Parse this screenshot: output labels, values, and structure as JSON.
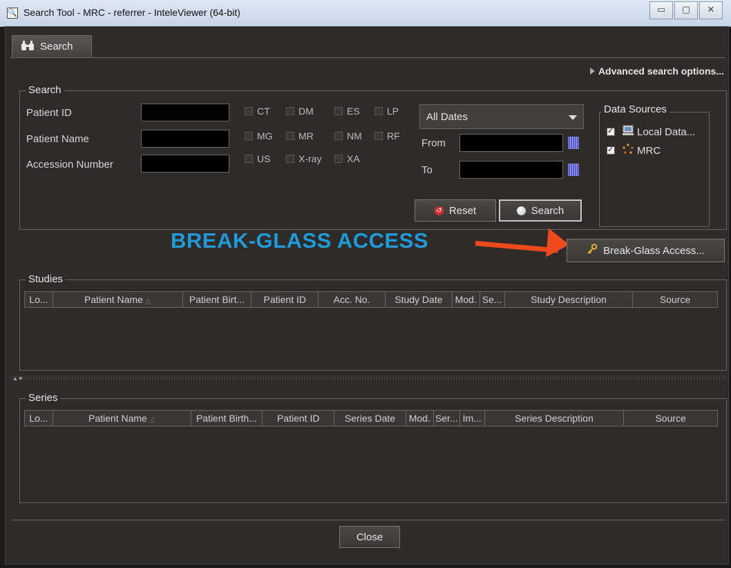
{
  "window": {
    "title": "Search Tool - MRC - referrer - InteleViewer (64-bit)",
    "controls": [
      "▭",
      "▢",
      "✕"
    ]
  },
  "tab": {
    "label": "Search"
  },
  "advanced": {
    "label": "Advanced search options..."
  },
  "search_group": {
    "title": "Search",
    "fields": [
      {
        "label": "Patient ID",
        "value": ""
      },
      {
        "label": "Patient Name",
        "value": ""
      },
      {
        "label": "Accession Number",
        "value": ""
      }
    ],
    "modalities": [
      "CT",
      "DM",
      "ES",
      "LP",
      "MG",
      "MR",
      "NM",
      "RF",
      "US",
      "X-ray",
      "XA"
    ],
    "date_range": {
      "selected": "All Dates",
      "from_label": "From",
      "to_label": "To",
      "from_value": "",
      "to_value": ""
    },
    "reset_label": "Reset",
    "search_label": "Search"
  },
  "data_sources": {
    "title": "Data Sources",
    "items": [
      {
        "label": "Local Data...",
        "checked": true
      },
      {
        "label": "MRC",
        "checked": true
      }
    ]
  },
  "annotation": {
    "banner": "BREAK-GLASS ACCESS",
    "arrow_color": "#f04a1c",
    "banner_color": "#1e9bdb"
  },
  "break_glass": {
    "label": "Break-Glass Access..."
  },
  "studies": {
    "title": "Studies",
    "columns": [
      "Lo...",
      "Patient Name",
      "Patient Birt...",
      "Patient ID",
      "Acc. No.",
      "Study Date",
      "Mod.",
      "Se...",
      "Study Description",
      "Source"
    ]
  },
  "series": {
    "title": "Series",
    "columns": [
      "Lo...",
      "Patient Name",
      "Patient Birth...",
      "Patient ID",
      "Series Date",
      "Mod.",
      "Ser...",
      "Im...",
      "Series Description",
      "Source"
    ]
  },
  "footer": {
    "close_label": "Close"
  }
}
